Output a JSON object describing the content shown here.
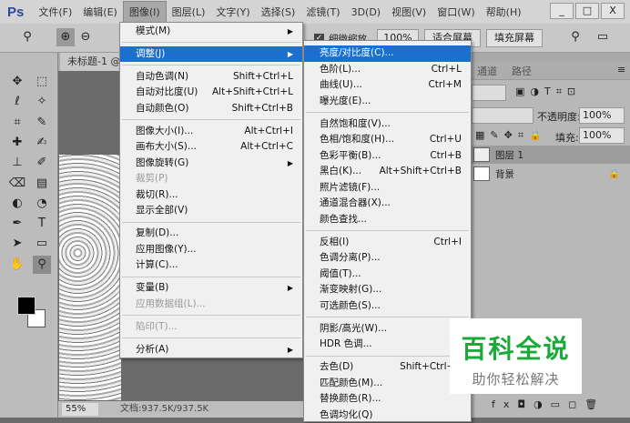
{
  "app": {
    "logo": "Ps"
  },
  "menubar": [
    "文件(F)",
    "编辑(E)",
    "图像(I)",
    "图层(L)",
    "文字(Y)",
    "选择(S)",
    "滤镜(T)",
    "3D(D)",
    "视图(V)",
    "窗口(W)",
    "帮助(H)"
  ],
  "window_buttons": [
    "_",
    "□",
    "X"
  ],
  "options": {
    "scrubby_zoom": "细微缩放",
    "zoom_value": "100%",
    "fit_screen": "适合屏幕",
    "fill_screen": "填充屏幕"
  },
  "document": {
    "tab": "未标题-1 @",
    "zoom": "55%",
    "doc_size": "文档:937.5K/937.5K"
  },
  "image_menu": [
    {
      "label": "模式(M)",
      "sub": true
    },
    {
      "sep": true
    },
    {
      "label": "调整(J)",
      "sub": true,
      "hl": true
    },
    {
      "sep": true
    },
    {
      "label": "自动色调(N)",
      "sc": "Shift+Ctrl+L"
    },
    {
      "label": "自动对比度(U)",
      "sc": "Alt+Shift+Ctrl+L"
    },
    {
      "label": "自动颜色(O)",
      "sc": "Shift+Ctrl+B"
    },
    {
      "sep": true
    },
    {
      "label": "图像大小(I)...",
      "sc": "Alt+Ctrl+I"
    },
    {
      "label": "画布大小(S)...",
      "sc": "Alt+Ctrl+C"
    },
    {
      "label": "图像旋转(G)",
      "sub": true
    },
    {
      "label": "裁剪(P)",
      "dis": true
    },
    {
      "label": "裁切(R)..."
    },
    {
      "label": "显示全部(V)"
    },
    {
      "sep": true
    },
    {
      "label": "复制(D)..."
    },
    {
      "label": "应用图像(Y)..."
    },
    {
      "label": "计算(C)..."
    },
    {
      "sep": true
    },
    {
      "label": "变量(B)",
      "sub": true
    },
    {
      "label": "应用数据组(L)...",
      "dis": true
    },
    {
      "sep": true
    },
    {
      "label": "陷印(T)...",
      "dis": true
    },
    {
      "sep": true
    },
    {
      "label": "分析(A)",
      "sub": true
    }
  ],
  "adjust_menu": [
    {
      "label": "亮度/对比度(C)...",
      "hl": true
    },
    {
      "label": "色阶(L)...",
      "sc": "Ctrl+L"
    },
    {
      "label": "曲线(U)...",
      "sc": "Ctrl+M"
    },
    {
      "label": "曝光度(E)..."
    },
    {
      "sep": true
    },
    {
      "label": "自然饱和度(V)..."
    },
    {
      "label": "色相/饱和度(H)...",
      "sc": "Ctrl+U"
    },
    {
      "label": "色彩平衡(B)...",
      "sc": "Ctrl+B"
    },
    {
      "label": "黑白(K)...",
      "sc": "Alt+Shift+Ctrl+B"
    },
    {
      "label": "照片滤镜(F)..."
    },
    {
      "label": "通道混合器(X)..."
    },
    {
      "label": "颜色查找..."
    },
    {
      "sep": true
    },
    {
      "label": "反相(I)",
      "sc": "Ctrl+I"
    },
    {
      "label": "色调分离(P)..."
    },
    {
      "label": "阈值(T)..."
    },
    {
      "label": "渐变映射(G)..."
    },
    {
      "label": "可选颜色(S)..."
    },
    {
      "sep": true
    },
    {
      "label": "阴影/高光(W)..."
    },
    {
      "label": "HDR 色调..."
    },
    {
      "sep": true
    },
    {
      "label": "去色(D)",
      "sc": "Shift+Ctrl+U"
    },
    {
      "label": "匹配颜色(M)..."
    },
    {
      "label": "替换颜色(R)..."
    },
    {
      "label": "色调均化(Q)"
    }
  ],
  "panel": {
    "tabs": [
      "通道",
      "路径"
    ],
    "opacity_label": "不透明度:",
    "opacity": "100%",
    "fill_label": "填充:",
    "fill": "100%",
    "layers": [
      "图层 1",
      "背景"
    ]
  },
  "watermark": {
    "title": "百科全说",
    "subtitle": "助你轻松解决"
  },
  "colors": {
    "highlight": "#1a6fcf",
    "watermark_green": "#1aaa3a"
  }
}
